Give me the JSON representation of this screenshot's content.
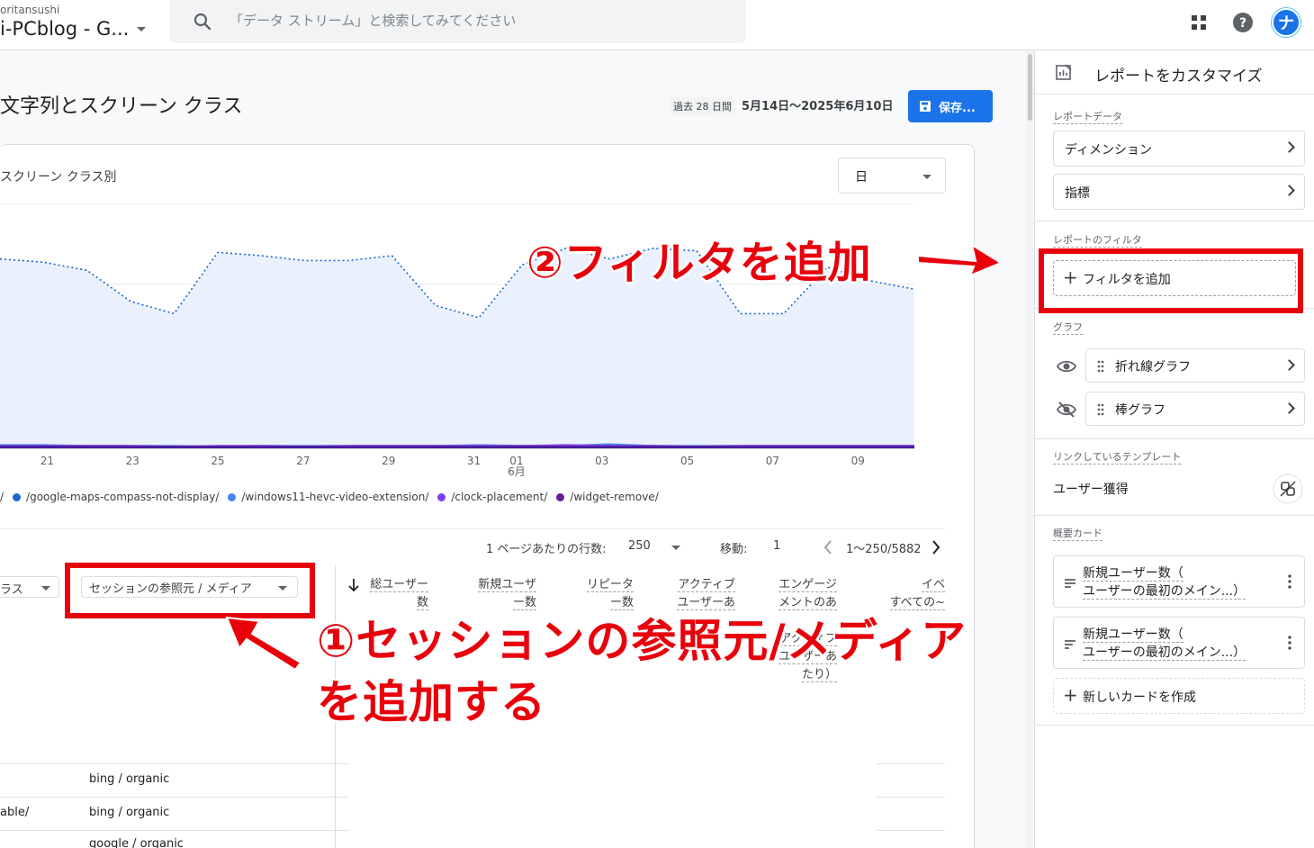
{
  "header": {
    "account": "oritansushi",
    "property": "i-PCblog - G...",
    "search_placeholder": "「データ ストリーム」と検索してみてください",
    "avatar_letter": "ナ"
  },
  "report": {
    "title": "文字列とスクリーン クラス",
    "date_badge": "過去 28 日間",
    "date_range": "5月14日～2025年6月10日",
    "save_label": "保存..."
  },
  "chart": {
    "title": "スクリーン クラス別",
    "granularity": "日",
    "legend": [
      "/",
      "/google-maps-compass-not-display/",
      "/windows11-hevc-video-extension/",
      "/clock-placement/",
      "/widget-remove/"
    ],
    "colors": {
      "main": "#1967d2",
      "fill": "#eaf1fc",
      "s1": "#1967d2",
      "s2": "#4285f4",
      "s3": "#7b3ff2",
      "s4": "#6a1b9a",
      "s5": "#3c1ea0"
    }
  },
  "chart_data": {
    "type": "line",
    "x": [
      "5/20",
      "5/21",
      "5/22",
      "5/23",
      "5/24",
      "5/25",
      "5/26",
      "5/27",
      "5/28",
      "5/29",
      "5/30",
      "5/31",
      "6/01",
      "6/02",
      "6/03",
      "6/04",
      "6/05",
      "6/06",
      "6/07",
      "6/08",
      "6/09",
      "6/10"
    ],
    "x_tick_labels": [
      "21",
      "23",
      "25",
      "27",
      "29",
      "31",
      "01",
      "03",
      "05",
      "07",
      "09"
    ],
    "x_tick_sublabel": "6月",
    "series": [
      {
        "values": [
          232,
          228,
          218,
          180,
          165,
          240,
          236,
          230,
          230,
          236,
          175,
          160,
          225,
          245,
          232,
          245,
          242,
          165,
          165,
          222,
          205,
          195
        ]
      },
      {
        "values": [
          4,
          4,
          3,
          3,
          3,
          2,
          3,
          3,
          3,
          3,
          3,
          4,
          3,
          3,
          5,
          3,
          3,
          3,
          3,
          3,
          3,
          3
        ]
      },
      {
        "values": [
          3,
          3,
          3,
          3,
          2,
          3,
          3,
          2,
          3,
          3,
          3,
          3,
          3,
          4,
          3,
          3,
          2,
          3,
          3,
          3,
          3,
          3
        ]
      },
      {
        "values": [
          2,
          2,
          2,
          2,
          2,
          2,
          2,
          2,
          2,
          2,
          2,
          2,
          2,
          2,
          2,
          2,
          2,
          2,
          2,
          2,
          2,
          2
        ]
      },
      {
        "values": [
          1,
          1,
          1,
          1,
          1,
          1,
          1,
          1,
          1,
          1,
          1,
          1,
          1,
          1,
          1,
          1,
          1,
          1,
          1,
          1,
          1,
          1
        ]
      }
    ],
    "ylim": [
      0,
      300
    ]
  },
  "pager": {
    "rows_label": "1 ページあたりの行数:",
    "rows_value": "250",
    "move_label": "移動:",
    "move_value": "1",
    "range": "1～250/5882"
  },
  "table": {
    "dim1_label": "ラス",
    "dim2_label": "セッションの参照元 / メディア",
    "columns": [
      [
        "総ユーザー",
        "数"
      ],
      [
        "新規ユーザ",
        "ー数"
      ],
      [
        "リピータ",
        "ー数"
      ],
      [
        "アクティブ",
        "ユーザーあ"
      ],
      [
        "エンゲージ",
        "メントのあ"
      ],
      [
        "イベ",
        "すべての~"
      ]
    ],
    "col5_tail": [
      "アクティブ",
      "ユーザーあ",
      "たり）"
    ],
    "rows": [
      {
        "left": "",
        "source": "bing / organic"
      },
      {
        "left": "able/",
        "source": "bing / organic"
      },
      {
        "left": "",
        "source": "google / organic"
      }
    ]
  },
  "side": {
    "title": "レポートをカスタマイズ",
    "report_data_label": "レポートデータ",
    "dimension": "ディメンション",
    "metric": "指標",
    "filter_label": "レポートのフィルタ",
    "add_filter": "フィルタを追加",
    "graph_label": "グラフ",
    "line_graph": "折れ線グラフ",
    "bar_graph": "棒グラフ",
    "linked_label": "リンクしているテンプレート",
    "linked_value": "ユーザー獲得",
    "summary_label": "概要カード",
    "card1_line1": "新規ユーザー数（",
    "card1_line2": "ユーザーの最初のメイン...）",
    "card2_line1": "新規ユーザー数（",
    "card2_line2": "ユーザーの最初のメイン...）",
    "new_card": "新しいカードを作成"
  },
  "annotations": {
    "step2": "②フィルタを追加",
    "step1_line1": "①セッションの参照元/メディア",
    "step1_line2": "を追加する"
  }
}
